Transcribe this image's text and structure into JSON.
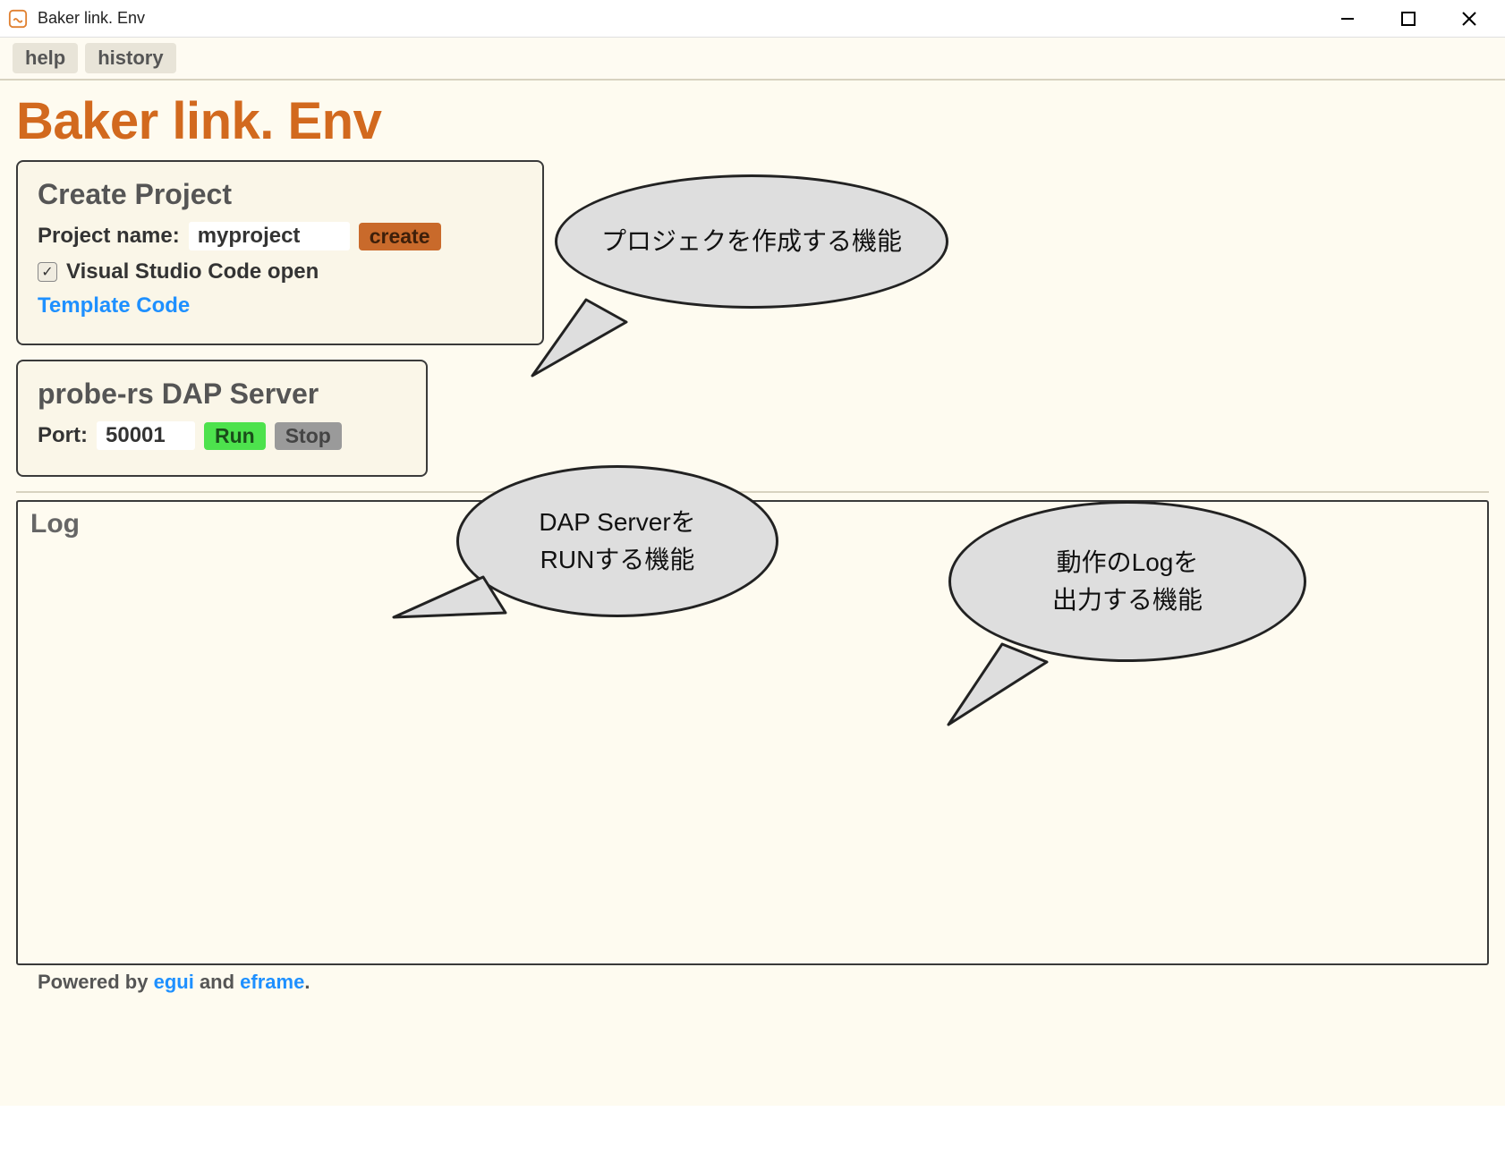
{
  "window": {
    "title": "Baker link. Env"
  },
  "menu": {
    "help": "help",
    "history": "history"
  },
  "app_title": "Baker link. Env",
  "create_project": {
    "heading": "Create Project",
    "name_label": "Project name:",
    "name_value": "myproject",
    "create_btn": "create",
    "vscode_checked": true,
    "vscode_label": "Visual Studio Code open",
    "template_link": "Template Code"
  },
  "dap_server": {
    "heading": "probe-rs DAP Server",
    "port_label": "Port:",
    "port_value": "50001",
    "run_btn": "Run",
    "stop_btn": "Stop"
  },
  "log": {
    "heading": "Log"
  },
  "footer": {
    "prefix": "Powered by ",
    "link1": "egui",
    "mid": " and ",
    "link2": "eframe",
    "suffix": "."
  },
  "annotations": {
    "bubble1": "プロジェクを作成する機能",
    "bubble2_line1": "DAP Serverを",
    "bubble2_line2": "RUNする機能",
    "bubble3_line1": "動作のLogを",
    "bubble3_line2": "出力する機能"
  }
}
